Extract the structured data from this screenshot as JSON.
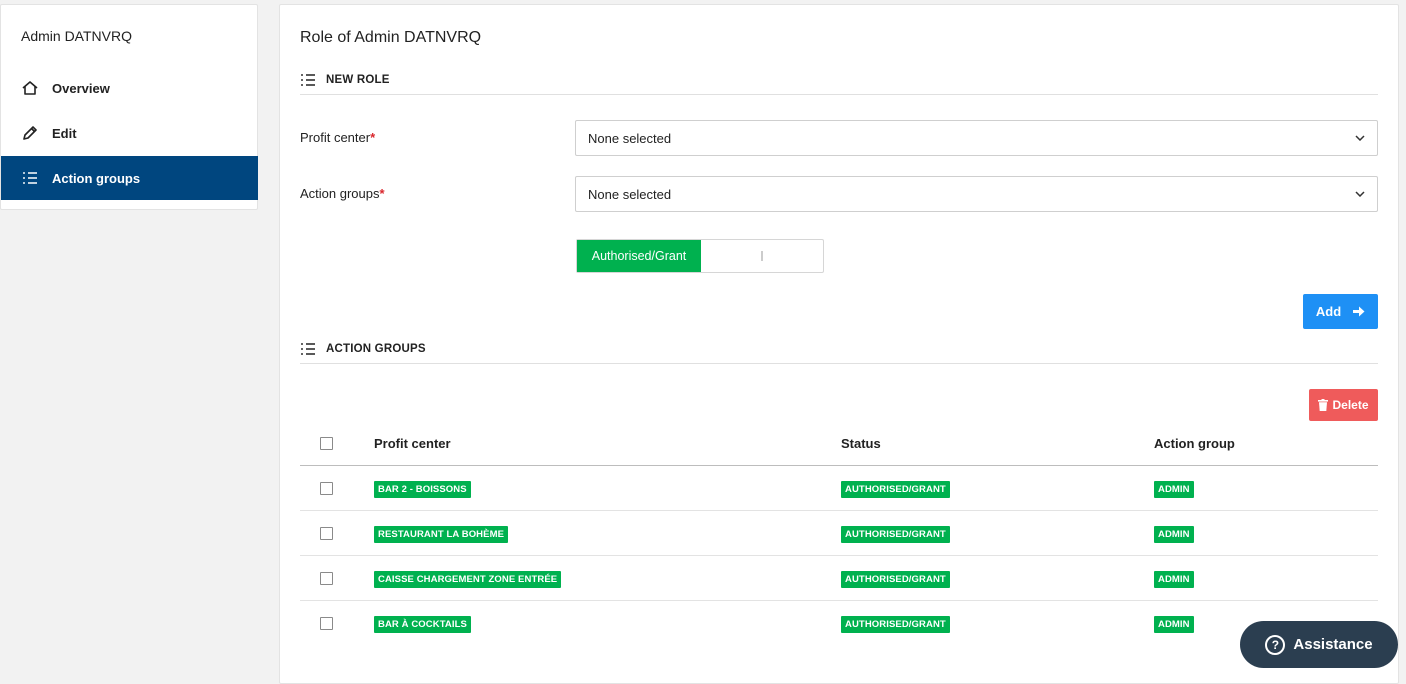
{
  "sidebar": {
    "title": "Admin DATNVRQ",
    "items": [
      {
        "label": "Overview",
        "icon": "home-icon"
      },
      {
        "label": "Edit",
        "icon": "pencil-icon"
      },
      {
        "label": "Action groups",
        "icon": "list-icon",
        "active": true
      }
    ]
  },
  "main": {
    "title": "Role of Admin DATNVRQ",
    "new_role": {
      "heading": "NEW ROLE",
      "profit_center_label": "Profit center",
      "profit_center_value": "None selected",
      "action_groups_label": "Action groups",
      "action_groups_value": "None selected",
      "required_mark": "*",
      "toggle_label": "Authorised/Grant",
      "add_label": "Add"
    },
    "action_groups": {
      "heading": "ACTION GROUPS",
      "delete_label": "Delete",
      "columns": [
        "Profit center",
        "Status",
        "Action group"
      ],
      "rows": [
        {
          "profit_center": "BAR 2 - BOISSONS",
          "status": "AUTHORISED/GRANT",
          "action_group": "ADMIN"
        },
        {
          "profit_center": "RESTAURANT LA BOHÈME",
          "status": "AUTHORISED/GRANT",
          "action_group": "ADMIN"
        },
        {
          "profit_center": "CAISSE CHARGEMENT ZONE ENTRÉE",
          "status": "AUTHORISED/GRANT",
          "action_group": "ADMIN"
        },
        {
          "profit_center": "BAR À COCKTAILS",
          "status": "AUTHORISED/GRANT",
          "action_group": "ADMIN"
        }
      ]
    }
  },
  "assistance": {
    "label": "Assistance"
  },
  "colors": {
    "primary": "#00467f",
    "success": "#00b14f",
    "add": "#1e90f5",
    "danger": "#ef5b5b",
    "assist": "#2b3e50"
  }
}
